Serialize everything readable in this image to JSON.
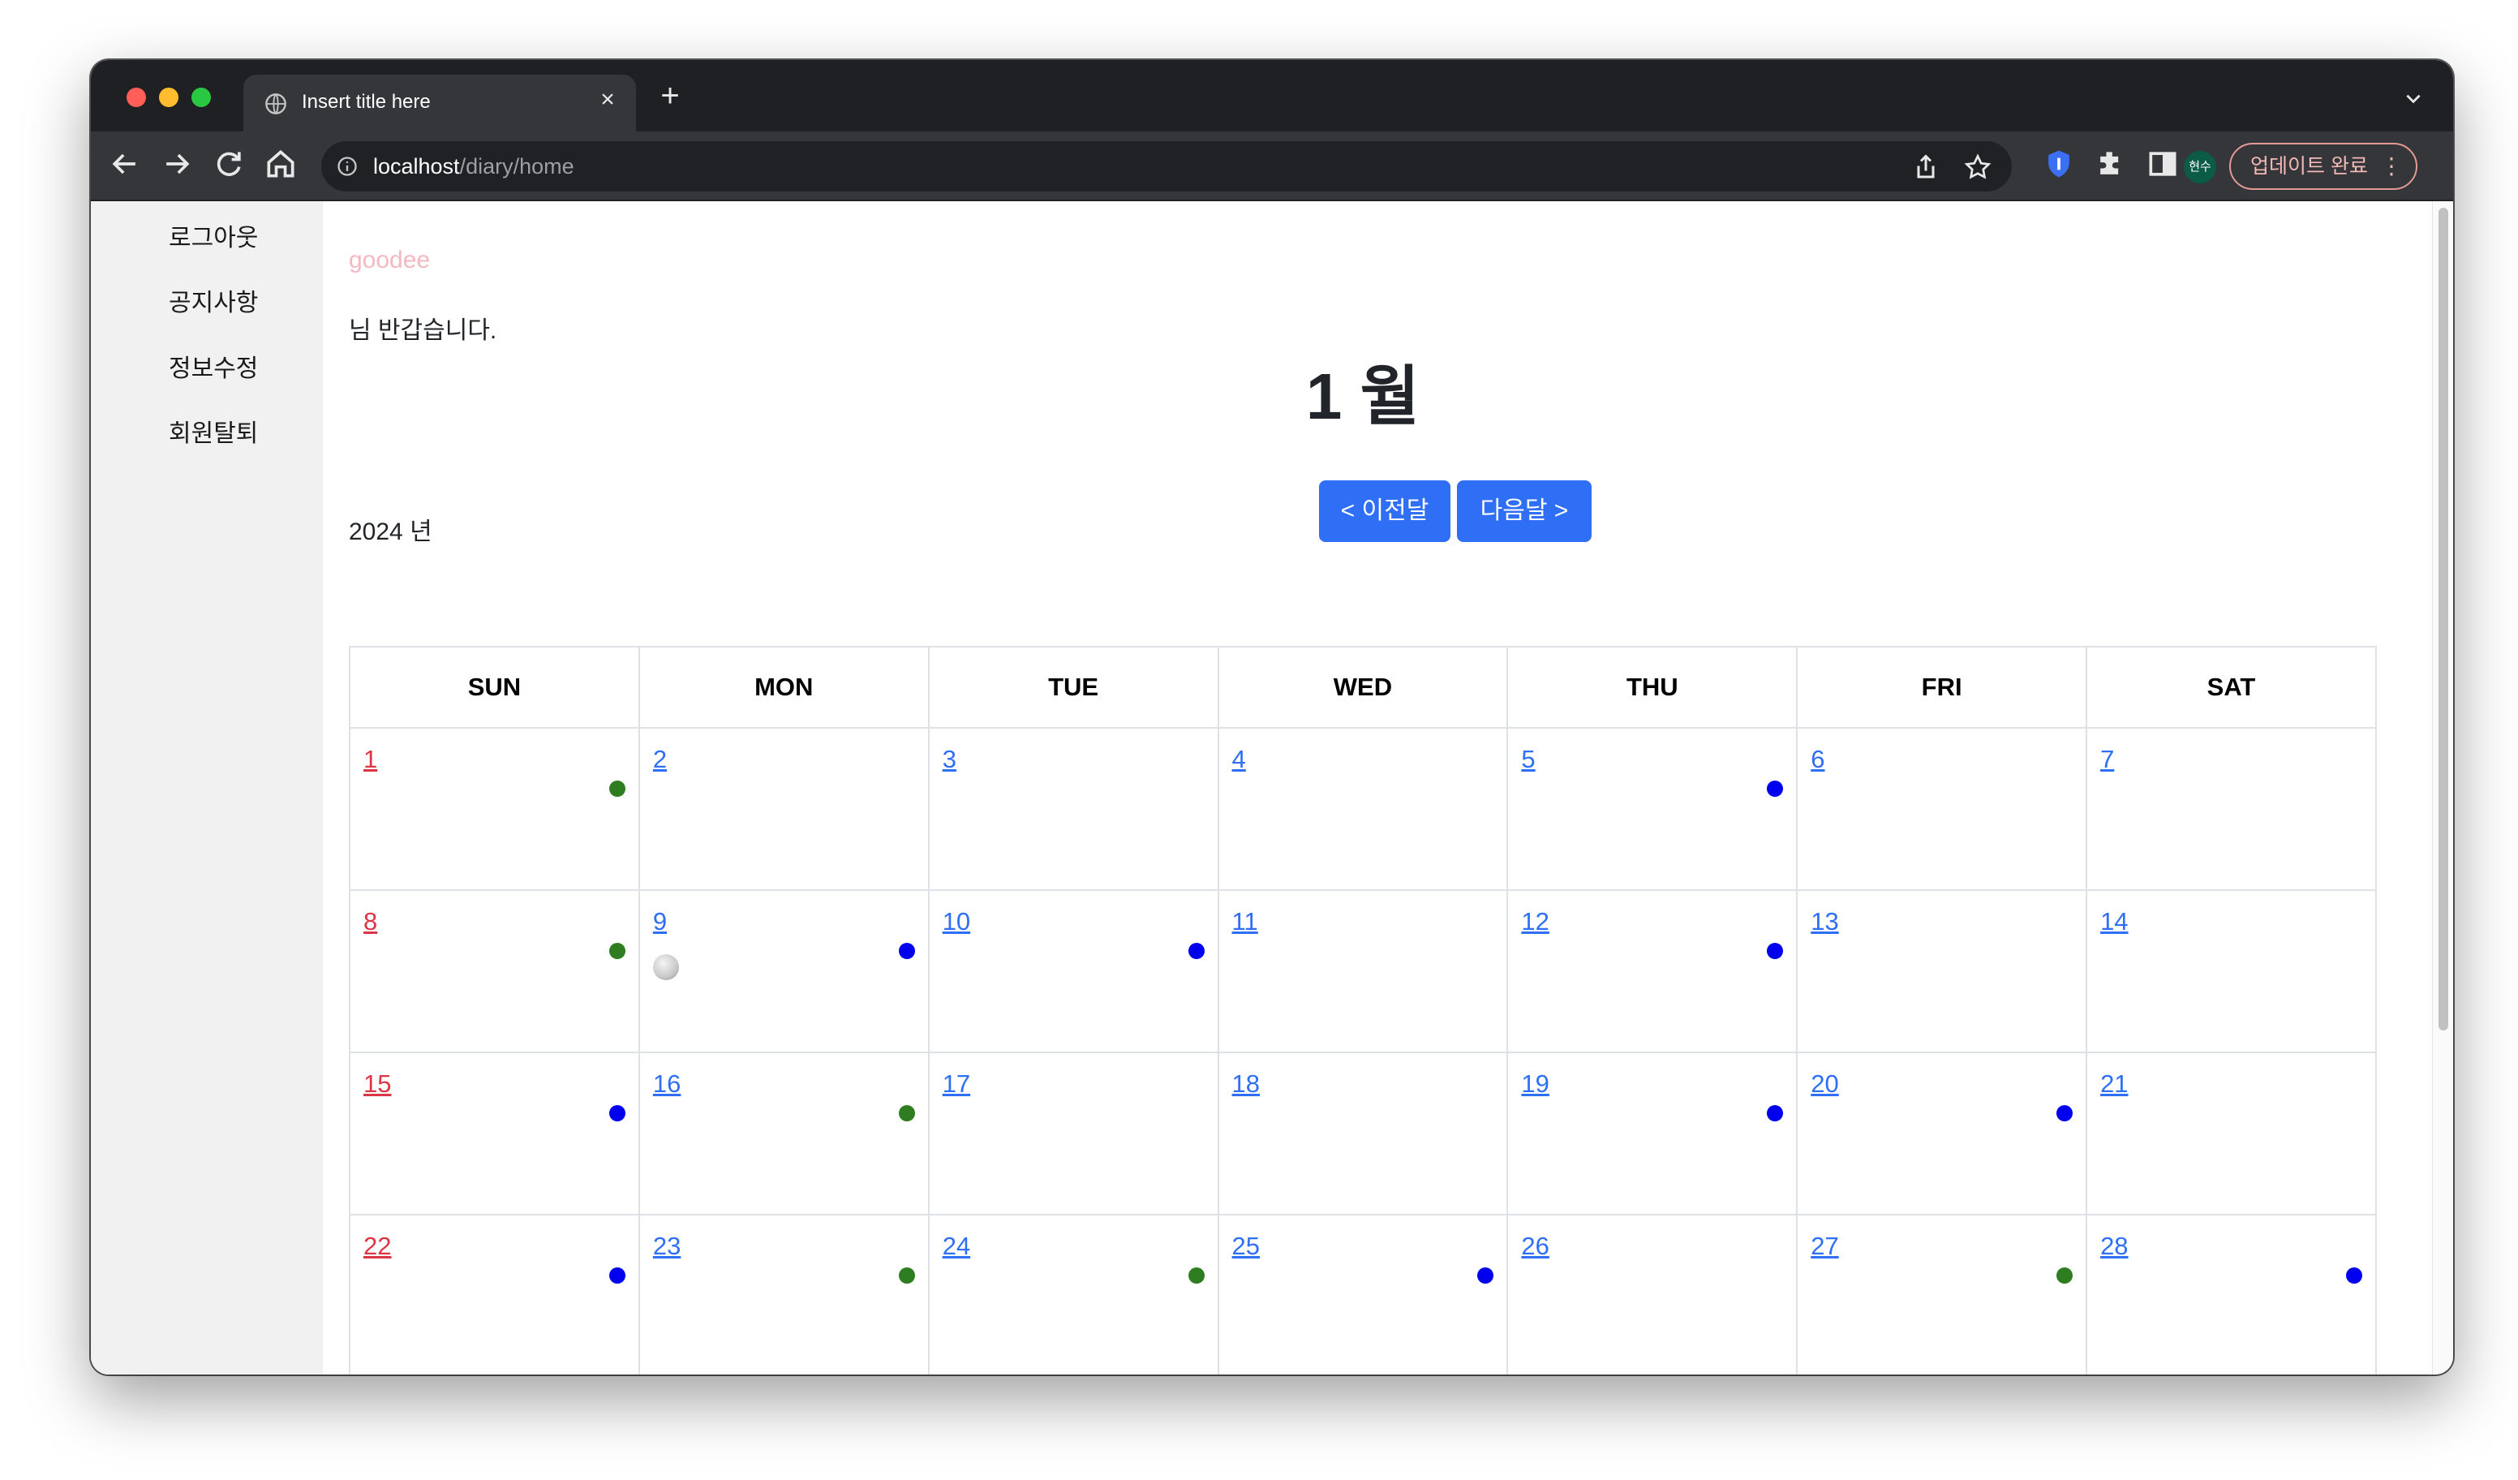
{
  "browser": {
    "tab_title": "Insert title here",
    "tab_close": "×",
    "new_tab": "+",
    "url_host": "localhost",
    "url_path": "/diary/home",
    "profile_label": "현수",
    "update_label": "업데이트 완료",
    "update_menu": "⋮"
  },
  "sidebar": {
    "items": [
      {
        "label": "로그아웃"
      },
      {
        "label": "공지사항"
      },
      {
        "label": "정보수정"
      },
      {
        "label": "회원탈퇴"
      }
    ]
  },
  "main": {
    "user_id": "goodee",
    "welcome": "님 반갑습니다.",
    "month": "1 월",
    "year": "2024 년",
    "prev_button": "< 이전달",
    "next_button": "다음달 >"
  },
  "calendar": {
    "weekdays": [
      "SUN",
      "MON",
      "TUE",
      "WED",
      "THU",
      "FRI",
      "SAT"
    ],
    "weeks": [
      [
        {
          "day": "1",
          "dot": "green"
        },
        {
          "day": "2",
          "dot": ""
        },
        {
          "day": "3",
          "dot": ""
        },
        {
          "day": "4",
          "dot": ""
        },
        {
          "day": "5",
          "dot": "blue"
        },
        {
          "day": "6",
          "dot": ""
        },
        {
          "day": "7",
          "dot": ""
        }
      ],
      [
        {
          "day": "8",
          "dot": "green"
        },
        {
          "day": "9",
          "dot": "blue",
          "moon": true
        },
        {
          "day": "10",
          "dot": "blue"
        },
        {
          "day": "11",
          "dot": ""
        },
        {
          "day": "12",
          "dot": "blue"
        },
        {
          "day": "13",
          "dot": ""
        },
        {
          "day": "14",
          "dot": ""
        }
      ],
      [
        {
          "day": "15",
          "dot": "blue"
        },
        {
          "day": "16",
          "dot": "green"
        },
        {
          "day": "17",
          "dot": ""
        },
        {
          "day": "18",
          "dot": ""
        },
        {
          "day": "19",
          "dot": "blue"
        },
        {
          "day": "20",
          "dot": "blue"
        },
        {
          "day": "21",
          "dot": ""
        }
      ],
      [
        {
          "day": "22",
          "dot": "blue"
        },
        {
          "day": "23",
          "dot": "green"
        },
        {
          "day": "24",
          "dot": "green"
        },
        {
          "day": "25",
          "dot": "blue"
        },
        {
          "day": "26",
          "dot": ""
        },
        {
          "day": "27",
          "dot": "green"
        },
        {
          "day": "28",
          "dot": "blue"
        }
      ]
    ],
    "colors": {
      "sunday": "#dc3545",
      "weekday_link": "#2f6ff5",
      "dot_blue": "#0000ee",
      "dot_green": "#2e7d20"
    }
  }
}
